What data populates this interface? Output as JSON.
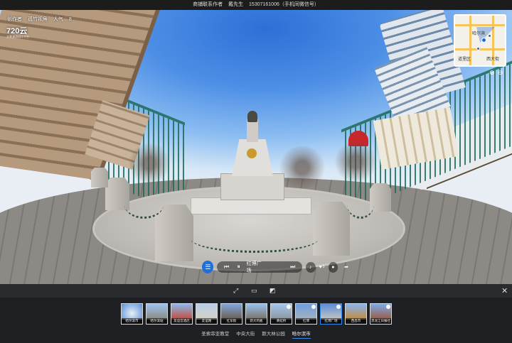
{
  "topbar": {
    "contact_label": "商铺联系作者",
    "contact_name": "戴先生",
    "contact_phone": "15307161006（手机同微信号）"
  },
  "credit": {
    "author_label": "创作者",
    "author_name": "孤竹视角",
    "views": "人气 ",
    "views_count": "8"
  },
  "logo": {
    "text": "720云",
    "sub": "全景漫游创作平台"
  },
  "minimap": {
    "city_label": "哈尔滨",
    "district_label": "道里区",
    "area_label": "西大街",
    "zoom_in": "⊕",
    "zoom_out": "⊖"
  },
  "controls": {
    "menu_icon": "☰",
    "prev_icon": "⏮",
    "pause_icon": "⏸",
    "track_label": "红博广场",
    "next_icon": "⏭",
    "audio_icon": "♪",
    "like_icon": "♥",
    "like_count": "0",
    "comment_icon": "●",
    "share_icon": "➦"
  },
  "toolbar": {
    "fullscreen_icon": "⤢",
    "vr_icon": "▭",
    "gyro_icon": "◩",
    "close_icon": "✕"
  },
  "scenes": [
    {
      "label": "哈尔滨市"
    },
    {
      "label": "哈尔滨站"
    },
    {
      "label": "友谊宫酒店"
    },
    {
      "label": "友谊路"
    },
    {
      "label": "红军街"
    },
    {
      "label": "新大鸡板"
    },
    {
      "label": "黄虹桥"
    },
    {
      "label": "红博"
    },
    {
      "label": "红博广场"
    },
    {
      "label": "西昌市"
    },
    {
      "label": "黑龙江日报社"
    }
  ],
  "groups": [
    {
      "label": "圣索菲亚教堂"
    },
    {
      "label": "中央大街"
    },
    {
      "label": "斯大林公园"
    },
    {
      "label": "哈尔滨市"
    }
  ],
  "colors": {
    "accent": "#2f8af0",
    "panel": "#1f2023"
  }
}
